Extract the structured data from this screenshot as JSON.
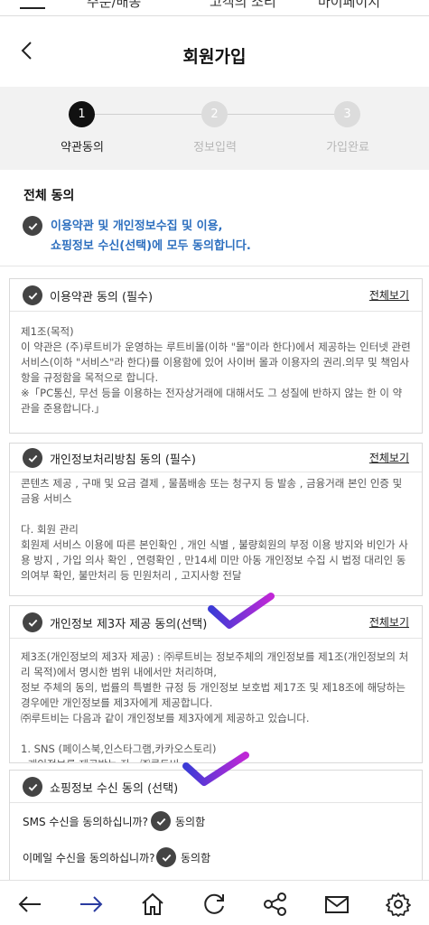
{
  "top_nav": {
    "items": [
      "주문/배송",
      "고객의 소리",
      "마이페이지"
    ]
  },
  "header": {
    "title": "회원가입",
    "back_icon": "back-arrow-icon"
  },
  "stepper": {
    "steps": [
      {
        "number": "1",
        "label": "약관동의",
        "state": "active"
      },
      {
        "number": "2",
        "label": "정보입력",
        "state": "inactive"
      },
      {
        "number": "3",
        "label": "가입완료",
        "state": "inactive"
      }
    ]
  },
  "all_agree": {
    "title": "전체 동의",
    "text_line1": "이용약관 및 개인정보수집 및 이용,",
    "text_line2": "쇼핑정보 수신(선택)에 모두 동의합니다."
  },
  "sections": [
    {
      "title": "이용약관 동의 (필수)",
      "view_all": "전체보기",
      "body": "제1조(목적)\n이 약관은 (주)루트비가 운영하는 루트비몰(이하 \"몰\"이라 한다)에서 제공하는 인터넷 관련 서비스(이하 \"서비스\"라 한다)를 이용함에 있어 사이버 몰과 이용자의 권리.의무 및 책임사항을 규정함을 목적으로 합니다.\n※「PC통신, 무선 등을 이용하는 전자상거래에 대해서도 그 성질에 반하지 않는 한 이 약관을 준용합니다.」"
    },
    {
      "title": "개인정보처리방침 동의 (필수)",
      "view_all": "전체보기",
      "body": "콘텐츠 제공 , 구매 및 요금 결제 , 물품배송 또는 청구지 등 발송 , 금융거래 본인 인증 및 금융 서비스\n\n다. 회원 관리\n회원제 서비스 이용에 따른 본인확인 , 개인 식별 , 불량회원의 부정 이용 방지와 비인가 사용 방지 , 가입 의사 확인 , 연령확인 , 만14세 미만 아동 개인정보 수집 시 법정 대리인 동의여부 확인, 불만처리 등 민원처리 , 고지사항 전달"
    },
    {
      "title": "개인정보 제3자 제공 동의(선택)",
      "view_all": "전체보기",
      "body": "제3조(개인정보의 제3자 제공) : ㈜루트비는 정보주체의 개인정보를 제1조(개인정보의 처리 목적)에서 명시한 범위 내에서만 처리하며,\n정보 주체의 동의, 법률의 특별한 규정 등 개인정보 보호법 제17조 및 제18조에 해당하는 경우에만 개인정보를 제3자에게 제공합니다.\n㈜루트비는 다음과 같이 개인정보를 제3자에게 제공하고 있습니다.\n\n1. SNS (페이스북,인스타그램,카카오스토리)\n- 개인정보를 제공받는 자 : ㈜루트비"
    }
  ],
  "shopping": {
    "title": "쇼핑정보 수신 동의 (선택)",
    "sms_question": "SMS 수신을 동의하십니까?",
    "sms_answer": "동의함",
    "email_question": "이메일 수신을 동의하십니까?",
    "email_answer": "동의함"
  },
  "bottom_bar": {
    "icons": [
      "back-icon",
      "forward-icon",
      "home-icon",
      "refresh-icon",
      "share-icon",
      "mail-icon",
      "settings-icon"
    ]
  },
  "colors": {
    "accent_blue": "#2d6fbf",
    "check_dark": "#444444",
    "stepper_bg": "#f2f2f2",
    "annotation_purple": "#7b2ff7",
    "bottom_icon_blue": "#2a3ba0"
  }
}
